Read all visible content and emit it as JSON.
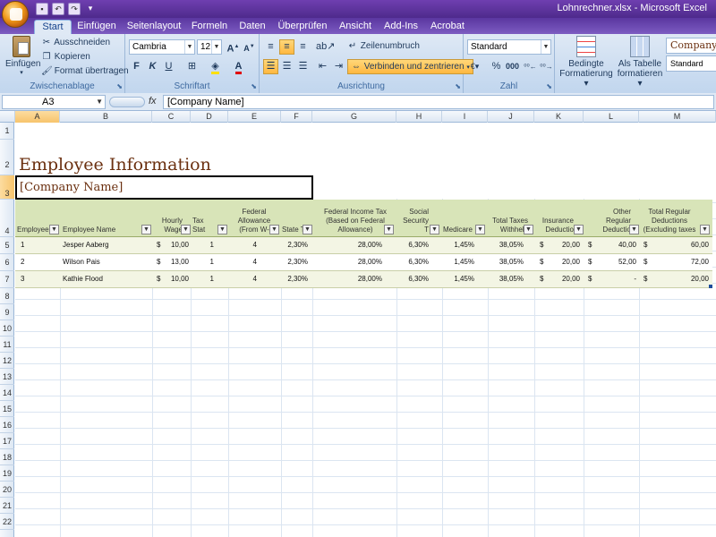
{
  "window": {
    "title": "Lohnrechner.xlsx - Microsoft Excel"
  },
  "tabs": [
    "Start",
    "Einfügen",
    "Seitenlayout",
    "Formeln",
    "Daten",
    "Überprüfen",
    "Ansicht",
    "Add-Ins",
    "Acrobat"
  ],
  "ribbon": {
    "clipboard": {
      "label": "Zwischenablage",
      "paste": "Einfügen",
      "cut": "Ausschneiden",
      "copy": "Kopieren",
      "format_painter": "Format übertragen"
    },
    "font": {
      "label": "Schriftart",
      "name": "Cambria",
      "size": "12"
    },
    "alignment": {
      "label": "Ausrichtung",
      "wrap": "Zeilenumbruch",
      "merge": "Verbinden und zentrieren"
    },
    "number": {
      "label": "Zahl",
      "format": "Standard"
    },
    "styles": {
      "conditional": "Bedingte Formatierung",
      "conditional_1": "Bedingte",
      "conditional_2": "Formatierung",
      "table_1": "Als Tabelle",
      "table_2": "formatieren",
      "style_company": "Company",
      "style_standard": "Standard"
    }
  },
  "formula_bar": {
    "name_box": "A3",
    "fx": "fx",
    "content": "[Company Name]"
  },
  "columns": [
    "A",
    "B",
    "C",
    "D",
    "E",
    "F",
    "G",
    "H",
    "I",
    "J",
    "K",
    "L",
    "M"
  ],
  "rows": [
    "1",
    "2",
    "3",
    "4",
    "5",
    "6",
    "7",
    "8",
    "9",
    "10",
    "11",
    "12",
    "13",
    "14",
    "15",
    "16",
    "17",
    "18",
    "19",
    "20",
    "21",
    "22"
  ],
  "sheet": {
    "title": "Employee Information",
    "company": "[Company Name]",
    "headers": {
      "employee": "Employee",
      "name": "Employee Name",
      "wage_1": "Hourly",
      "wage_2": "Wage",
      "tax_status": "Tax Stat",
      "fed_1": "Federal",
      "fed_2": "Allowance",
      "fed_3": "(From W-",
      "state": "State T",
      "fit_1": "Federal Income Tax",
      "fit_2": "(Based on Federal",
      "fit_3": "Allowance)",
      "ss_1": "Social",
      "ss_2": "Security T",
      "medicare": "Medicare",
      "tt_1": "Total Taxes",
      "tt_2": "Withheld",
      "ins_1": "Insurance",
      "ins_2": "Deductio",
      "other_1": "Other Regular",
      "other_2": "Deductio",
      "trd_1": "Total Regular",
      "trd_2": "Deductions",
      "trd_3": "(Excluding taxes"
    },
    "currency": "$",
    "data": [
      {
        "id": "1",
        "name": "Jesper Aaberg",
        "wage": "10,00",
        "tax": "1",
        "fed": "4",
        "state": "2,30%",
        "fit": "28,00%",
        "ss": "6,30%",
        "med": "1,45%",
        "tt": "38,05%",
        "ins": "20,00",
        "other": "40,00",
        "trd": "60,00"
      },
      {
        "id": "2",
        "name": "Wilson Pais",
        "wage": "13,00",
        "tax": "1",
        "fed": "4",
        "state": "2,30%",
        "fit": "28,00%",
        "ss": "6,30%",
        "med": "1,45%",
        "tt": "38,05%",
        "ins": "20,00",
        "other": "52,00",
        "trd": "72,00"
      },
      {
        "id": "3",
        "name": "Kathie Flood",
        "wage": "10,00",
        "tax": "1",
        "fed": "4",
        "state": "2,30%",
        "fit": "28,00%",
        "ss": "6,30%",
        "med": "1,45%",
        "tt": "38,05%",
        "ins": "20,00",
        "other": "-",
        "trd": "20,00"
      }
    ]
  }
}
